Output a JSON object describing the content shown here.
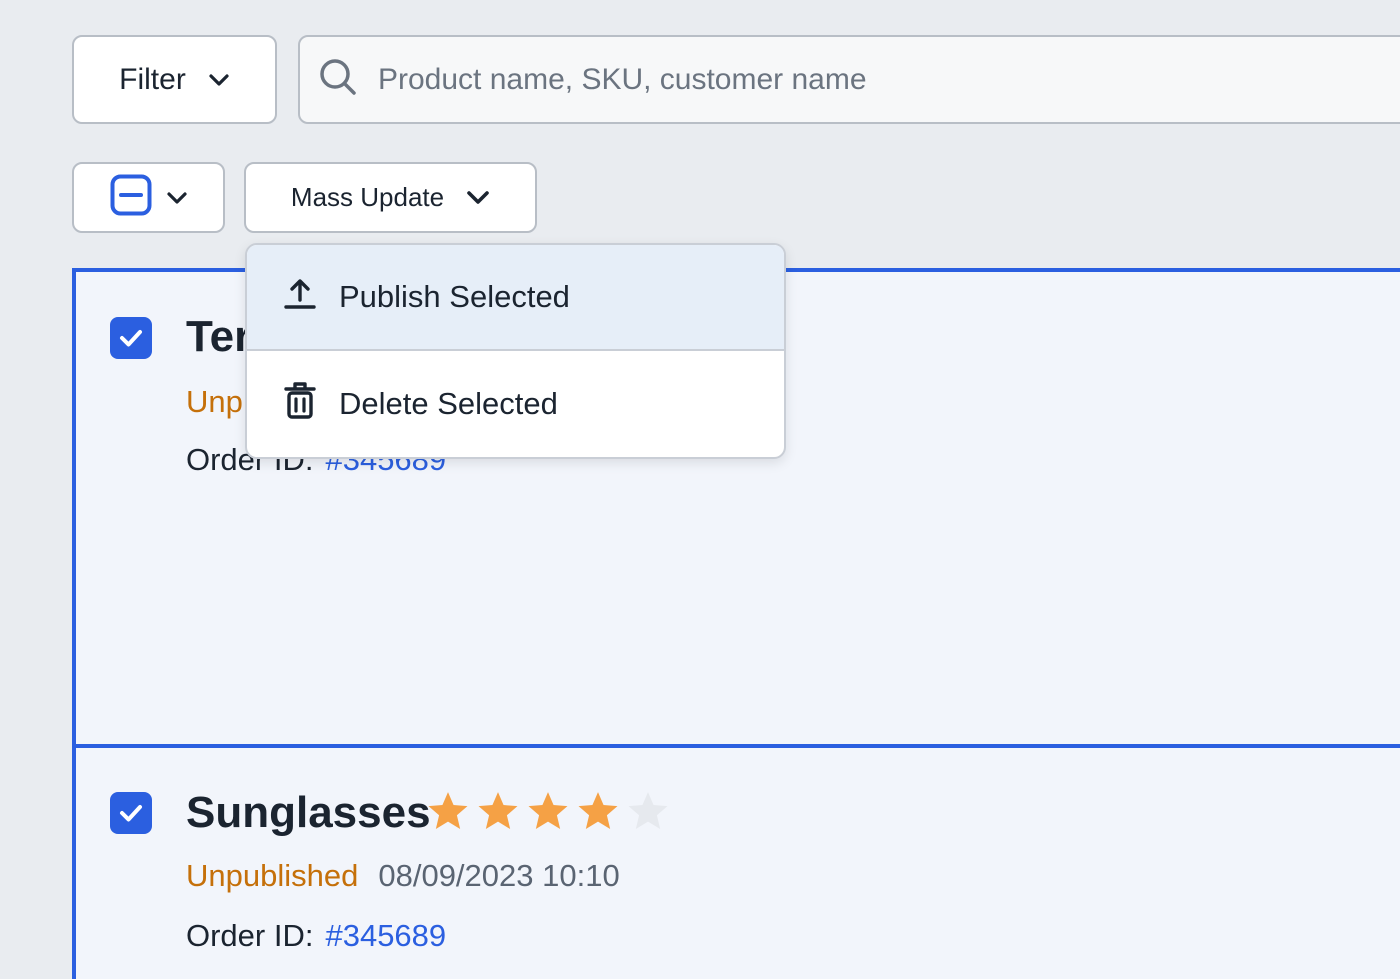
{
  "toolbar": {
    "filter_label": "Filter",
    "search_placeholder": "Product name, SKU, customer name",
    "search_value": "",
    "mass_update_label": "Mass Update"
  },
  "menu": {
    "items": [
      {
        "label": "Publish Selected",
        "icon": "upload-icon"
      },
      {
        "label": "Delete Selected",
        "icon": "trash-icon"
      }
    ]
  },
  "products": [
    {
      "title": "Ter",
      "status": "Unp",
      "order_label": "Order ID:",
      "order_id": "#345689"
    },
    {
      "title": "Sunglasses",
      "rating": 4,
      "rating_max": 5,
      "status": "Unpublished",
      "date": "08/09/2023 10:10",
      "order_label": "Order ID:",
      "order_id": "#345689"
    }
  ],
  "colors": {
    "accent": "#2b5fe0",
    "status_unpublished": "#c5700a",
    "star_filled": "#f5a145",
    "star_empty": "#e6e9ee"
  }
}
